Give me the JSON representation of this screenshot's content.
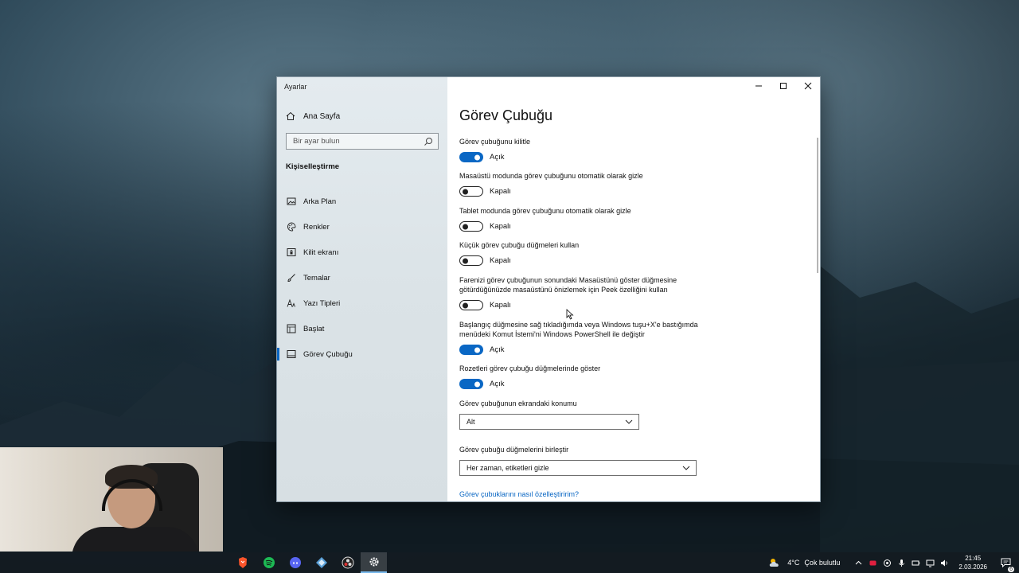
{
  "window": {
    "title": "Ayarlar"
  },
  "nav": {
    "home_label": "Ana Sayfa",
    "search_placeholder": "Bir ayar bulun",
    "section_title": "Kişiselleştirme",
    "items": [
      {
        "label": "Arka Plan",
        "icon": "image-icon"
      },
      {
        "label": "Renkler",
        "icon": "palette-icon"
      },
      {
        "label": "Kilit ekranı",
        "icon": "lock-screen-icon"
      },
      {
        "label": "Temalar",
        "icon": "brush-icon"
      },
      {
        "label": "Yazı Tipleri",
        "icon": "font-icon"
      },
      {
        "label": "Başlat",
        "icon": "start-icon"
      },
      {
        "label": "Görev Çubuğu",
        "icon": "taskbar-icon",
        "active": true
      }
    ]
  },
  "page": {
    "title": "Görev Çubuğu",
    "settings": [
      {
        "label": "Görev çubuğunu kilitle",
        "state": "Açık",
        "on": true
      },
      {
        "label": "Masaüstü modunda görev çubuğunu otomatik olarak gizle",
        "state": "Kapalı",
        "on": false
      },
      {
        "label": "Tablet modunda görev çubuğunu otomatik olarak gizle",
        "state": "Kapalı",
        "on": false
      },
      {
        "label": "Küçük görev çubuğu düğmeleri kullan",
        "state": "Kapalı",
        "on": false
      },
      {
        "label": "Farenizi görev çubuğunun sonundaki Masaüstünü göster düğmesine götürdüğünüzde masaüstünü önizlemek için Peek özelliğini kullan",
        "state": "Kapalı",
        "on": false
      },
      {
        "label": "Başlangıç düğmesine sağ tıkladığımda veya Windows tuşu+X'e bastığımda menüdeki Komut İstemi'ni Windows PowerShell ile değiştir",
        "state": "Açık",
        "on": true
      },
      {
        "label": "Rozetleri görev çubuğu düğmelerinde göster",
        "state": "Açık",
        "on": true
      }
    ],
    "position": {
      "label": "Görev çubuğunun ekrandaki konumu",
      "value": "Alt"
    },
    "combine": {
      "label": "Görev çubuğu düğmelerini birleştir",
      "value": "Her zaman, etiketleri gizle"
    },
    "help_link": "Görev çubuklarını nasıl özelleştiririm?"
  },
  "taskbar": {
    "apps": [
      "brave-icon",
      "spotify-icon",
      "discord-icon",
      "app-icon",
      "obs-icon",
      "settings-icon"
    ],
    "weather": {
      "temp": "4°C",
      "desc": "Çok bulutlu"
    },
    "time": "21:45",
    "date": "2.03.2026",
    "notification_count": "6"
  },
  "colors": {
    "accent": "#0a67c4"
  }
}
